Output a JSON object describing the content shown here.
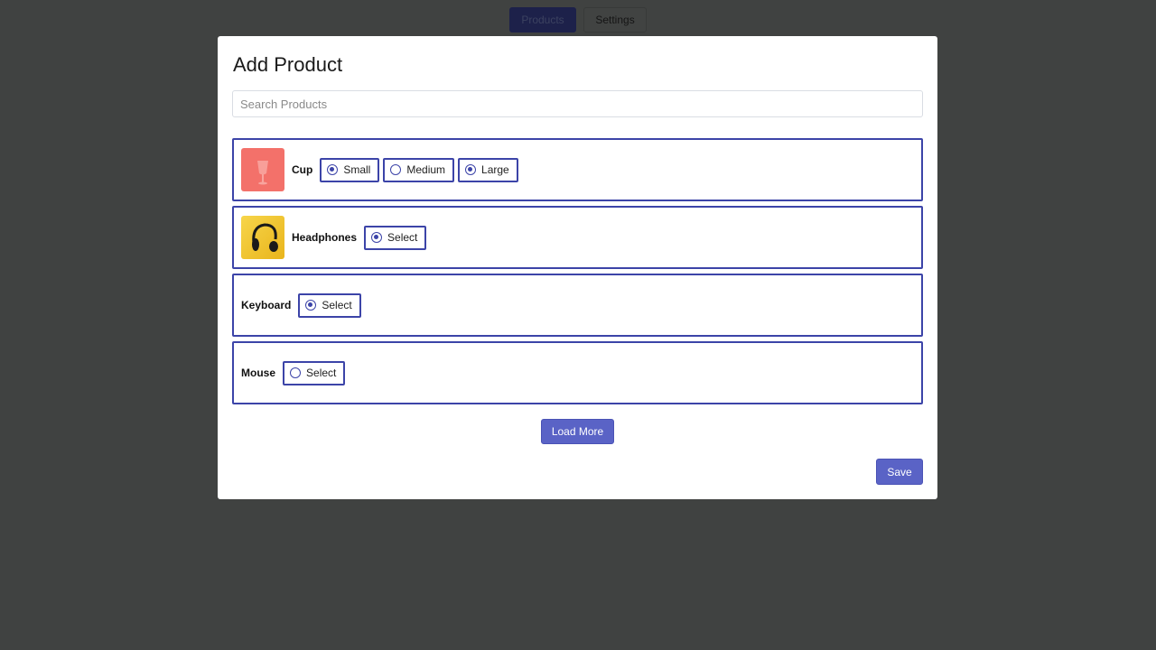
{
  "topnav": {
    "tabs": [
      {
        "label": "Products",
        "active": true
      },
      {
        "label": "Settings",
        "active": false
      }
    ]
  },
  "modal": {
    "title": "Add Product",
    "search": {
      "placeholder": "Search Products",
      "value": ""
    },
    "products": [
      {
        "name": "Cup",
        "image": "cup-image",
        "options": [
          {
            "label": "Small",
            "selected": true
          },
          {
            "label": "Medium",
            "selected": false
          },
          {
            "label": "Large",
            "selected": true
          }
        ]
      },
      {
        "name": "Headphones",
        "image": "headphones-image",
        "options": [
          {
            "label": "Select",
            "selected": true
          }
        ]
      },
      {
        "name": "Keyboard",
        "image": null,
        "options": [
          {
            "label": "Select",
            "selected": true
          }
        ]
      },
      {
        "name": "Mouse",
        "image": null,
        "options": [
          {
            "label": "Select",
            "selected": false
          }
        ]
      }
    ],
    "load_more_label": "Load More",
    "save_label": "Save"
  },
  "colors": {
    "accent": "#3c44a8",
    "button": "#5a63c6",
    "overlay": "#404241"
  }
}
